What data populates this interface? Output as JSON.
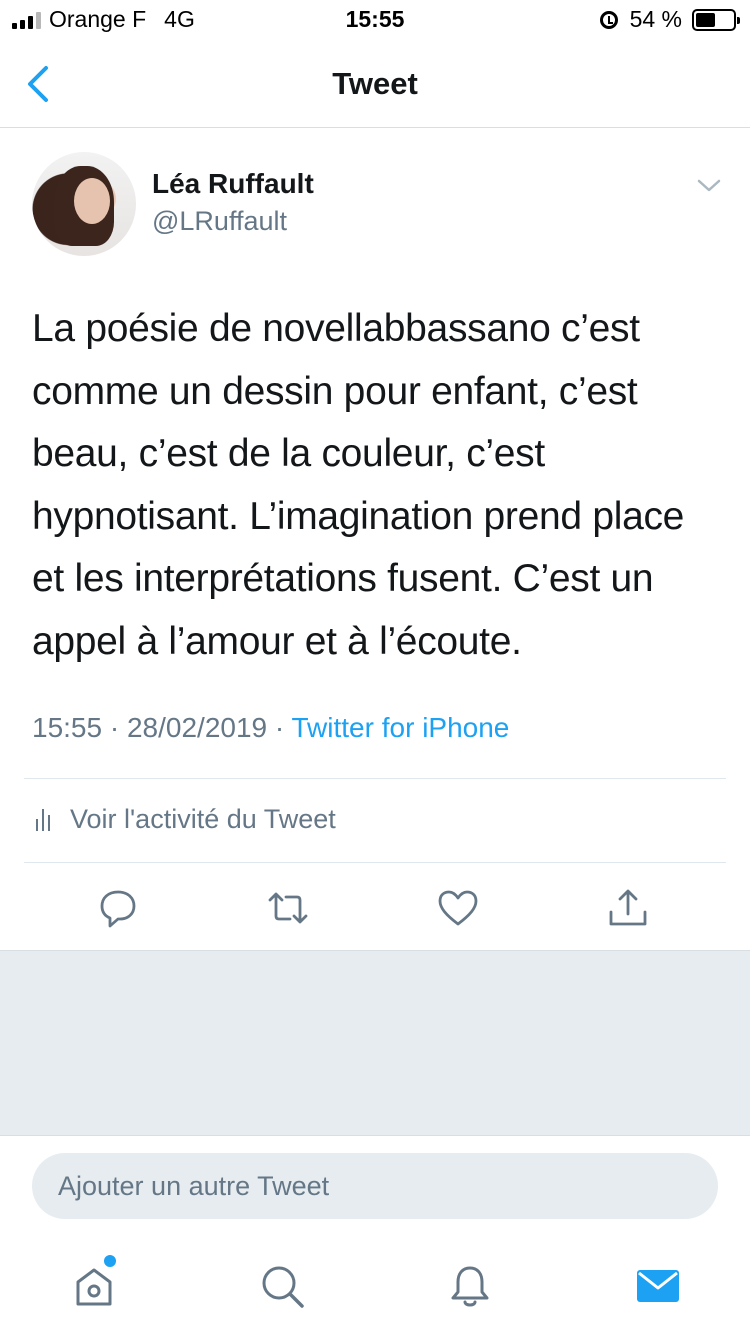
{
  "status_bar": {
    "carrier": "Orange F",
    "network": "4G",
    "time": "15:55",
    "battery": "54 %",
    "battery_level": 0.54
  },
  "header": {
    "title": "Tweet",
    "back_icon": "chevron-left-icon"
  },
  "tweet": {
    "author_name": "Léa Ruffault",
    "author_handle": "@LRuffault",
    "lines": [
      "La poésie de novellabbassano c’est",
      "comme un dessin pour enfant, c’est",
      "beau, c’est de la couleur, c’est",
      "hypnotisant. L’imagination prend place",
      "et les interprétations fusent. C’est un",
      "appel à l’amour et à l’écoute."
    ],
    "time": "15:55",
    "separator": " · ",
    "date": "28/02/2019",
    "source": "Twitter for iPhone",
    "activity_label": "Voir l'activité du Tweet"
  },
  "actions": [
    "reply-icon",
    "retweet-icon",
    "like-icon",
    "share-icon"
  ],
  "compose": {
    "placeholder": "Ajouter un autre Tweet"
  },
  "tabbar": [
    "home-icon",
    "search-icon",
    "notifications-icon",
    "messages-icon"
  ],
  "colors": {
    "accent": "#1da1f2",
    "secondary_text": "#657786",
    "background_gray": "#e6ecf0"
  }
}
